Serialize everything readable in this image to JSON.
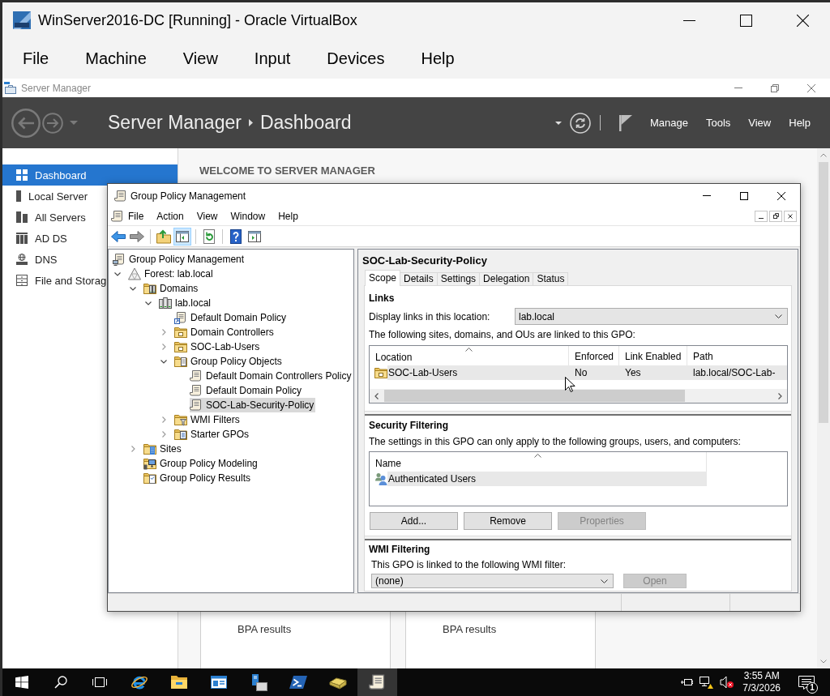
{
  "vbox": {
    "title": "WinServer2016-DC [Running] - Oracle VirtualBox",
    "menu": [
      "File",
      "Machine",
      "View",
      "Input",
      "Devices",
      "Help"
    ]
  },
  "server_manager": {
    "window_title": "Server Manager",
    "breadcrumb": [
      "Server Manager",
      "Dashboard"
    ],
    "menu": [
      "Manage",
      "Tools",
      "View",
      "Help"
    ],
    "nav": [
      {
        "label": "Dashboard",
        "kind": "dashboard",
        "selected": true
      },
      {
        "label": "Local Server",
        "kind": "server",
        "selected": false
      },
      {
        "label": "All Servers",
        "kind": "servers",
        "selected": false
      },
      {
        "label": "AD DS",
        "kind": "directory",
        "selected": false
      },
      {
        "label": "DNS",
        "kind": "dns",
        "selected": false
      },
      {
        "label": "File and Storag",
        "kind": "storage",
        "selected": false
      }
    ],
    "welcome_heading": "WELCOME TO SERVER MANAGER",
    "bpa_cards": [
      {
        "label": "BPA results"
      },
      {
        "label": "BPA results"
      }
    ]
  },
  "gpm": {
    "title": "Group Policy Management",
    "menu": [
      "File",
      "Action",
      "View",
      "Window",
      "Help"
    ],
    "toolbar": [
      [
        {
          "kind": "back",
          "pressed": false
        },
        {
          "kind": "forward",
          "pressed": false
        }
      ],
      [
        {
          "kind": "up-folder",
          "pressed": false
        },
        {
          "kind": "tree-pane",
          "pressed": true
        }
      ],
      [
        {
          "kind": "refresh",
          "pressed": false
        }
      ],
      [
        {
          "kind": "help",
          "pressed": false
        },
        {
          "kind": "action-pane",
          "pressed": false
        }
      ]
    ],
    "tree": [
      {
        "label": "Group Policy Management",
        "kind": "console",
        "selected": false,
        "children": [
          {
            "label": "Forest: lab.local",
            "kind": "forest",
            "expanded": true,
            "selected": false,
            "children": [
              {
                "label": "Domains",
                "kind": "domains",
                "expanded": true,
                "selected": false,
                "children": [
                  {
                    "label": "lab.local",
                    "kind": "domain",
                    "expanded": true,
                    "selected": false,
                    "children": [
                      {
                        "label": "Default Domain Policy",
                        "kind": "gpo-link",
                        "selected": false
                      },
                      {
                        "label": "Domain Controllers",
                        "kind": "ou",
                        "expanded": false,
                        "selected": false
                      },
                      {
                        "label": "SOC-Lab-Users",
                        "kind": "ou",
                        "expanded": false,
                        "selected": false
                      },
                      {
                        "label": "Group Policy Objects",
                        "kind": "gpo-folder",
                        "expanded": true,
                        "selected": false,
                        "children": [
                          {
                            "label": "Default Domain Controllers Policy",
                            "kind": "gpo",
                            "selected": false
                          },
                          {
                            "label": "Default Domain Policy",
                            "kind": "gpo",
                            "selected": false
                          },
                          {
                            "label": "SOC-Lab-Security-Policy",
                            "kind": "gpo",
                            "selected": true
                          }
                        ]
                      },
                      {
                        "label": "WMI Filters",
                        "kind": "wmi-folder",
                        "expanded": false,
                        "selected": false
                      },
                      {
                        "label": "Starter GPOs",
                        "kind": "starter-folder",
                        "expanded": false,
                        "selected": false
                      }
                    ]
                  }
                ]
              },
              {
                "label": "Sites",
                "kind": "sites",
                "expanded": false,
                "selected": false
              },
              {
                "label": "Group Policy Modeling",
                "kind": "modeling",
                "selected": false
              },
              {
                "label": "Group Policy Results",
                "kind": "results",
                "selected": false
              }
            ]
          }
        ]
      }
    ],
    "detail": {
      "title": "SOC-Lab-Security-Policy",
      "tabs": [
        {
          "label": "Scope",
          "selected": true
        },
        {
          "label": "Details",
          "selected": false
        },
        {
          "label": "Settings",
          "selected": false
        },
        {
          "label": "Delegation",
          "selected": false
        },
        {
          "label": "Status",
          "selected": false
        }
      ],
      "links": {
        "heading": "Links",
        "location_label": "Display links in this location:",
        "location_value": "lab.local",
        "caption": "The following sites, domains, and OUs are linked to this GPO:",
        "columns": [
          {
            "label": "Location",
            "sorted": true
          },
          {
            "label": "Enforced",
            "sorted": false
          },
          {
            "label": "Link Enabled",
            "sorted": false
          },
          {
            "label": "Path",
            "sorted": false
          }
        ],
        "rows": [
          {
            "kind": "ou",
            "selected": true,
            "cells": [
              "SOC-Lab-Users",
              "No",
              "Yes",
              "lab.local/SOC-Lab-"
            ]
          }
        ]
      },
      "security_filtering": {
        "heading": "Security Filtering",
        "caption": "The settings in this GPO can only apply to the following groups, users, and computers:",
        "columns": [
          {
            "label": "Name",
            "sorted": true
          }
        ],
        "rows": [
          {
            "kind": "group",
            "selected": true,
            "cells": [
              "Authenticated Users"
            ]
          }
        ],
        "buttons": [
          {
            "label": "Add...",
            "disabled": false
          },
          {
            "label": "Remove",
            "disabled": false
          },
          {
            "label": "Properties",
            "disabled": true
          }
        ]
      },
      "wmi_filtering": {
        "heading": "WMI Filtering",
        "caption": "This GPO is linked to the following WMI filter:",
        "filter_value": "(none)",
        "button": {
          "label": "Open",
          "disabled": true
        }
      }
    }
  },
  "taskbar": {
    "apps": [
      {
        "kind": "browser",
        "selected": false
      },
      {
        "kind": "file-explorer",
        "selected": false
      },
      {
        "kind": "server-manager",
        "selected": false
      },
      {
        "kind": "server-folder",
        "selected": false
      },
      {
        "kind": "powershell",
        "selected": false
      },
      {
        "kind": "tool",
        "selected": false
      },
      {
        "kind": "group-policy",
        "selected": true
      }
    ],
    "clock": {
      "time": "3:55 AM",
      "date": "7/3/2026"
    },
    "notifications": "1"
  }
}
